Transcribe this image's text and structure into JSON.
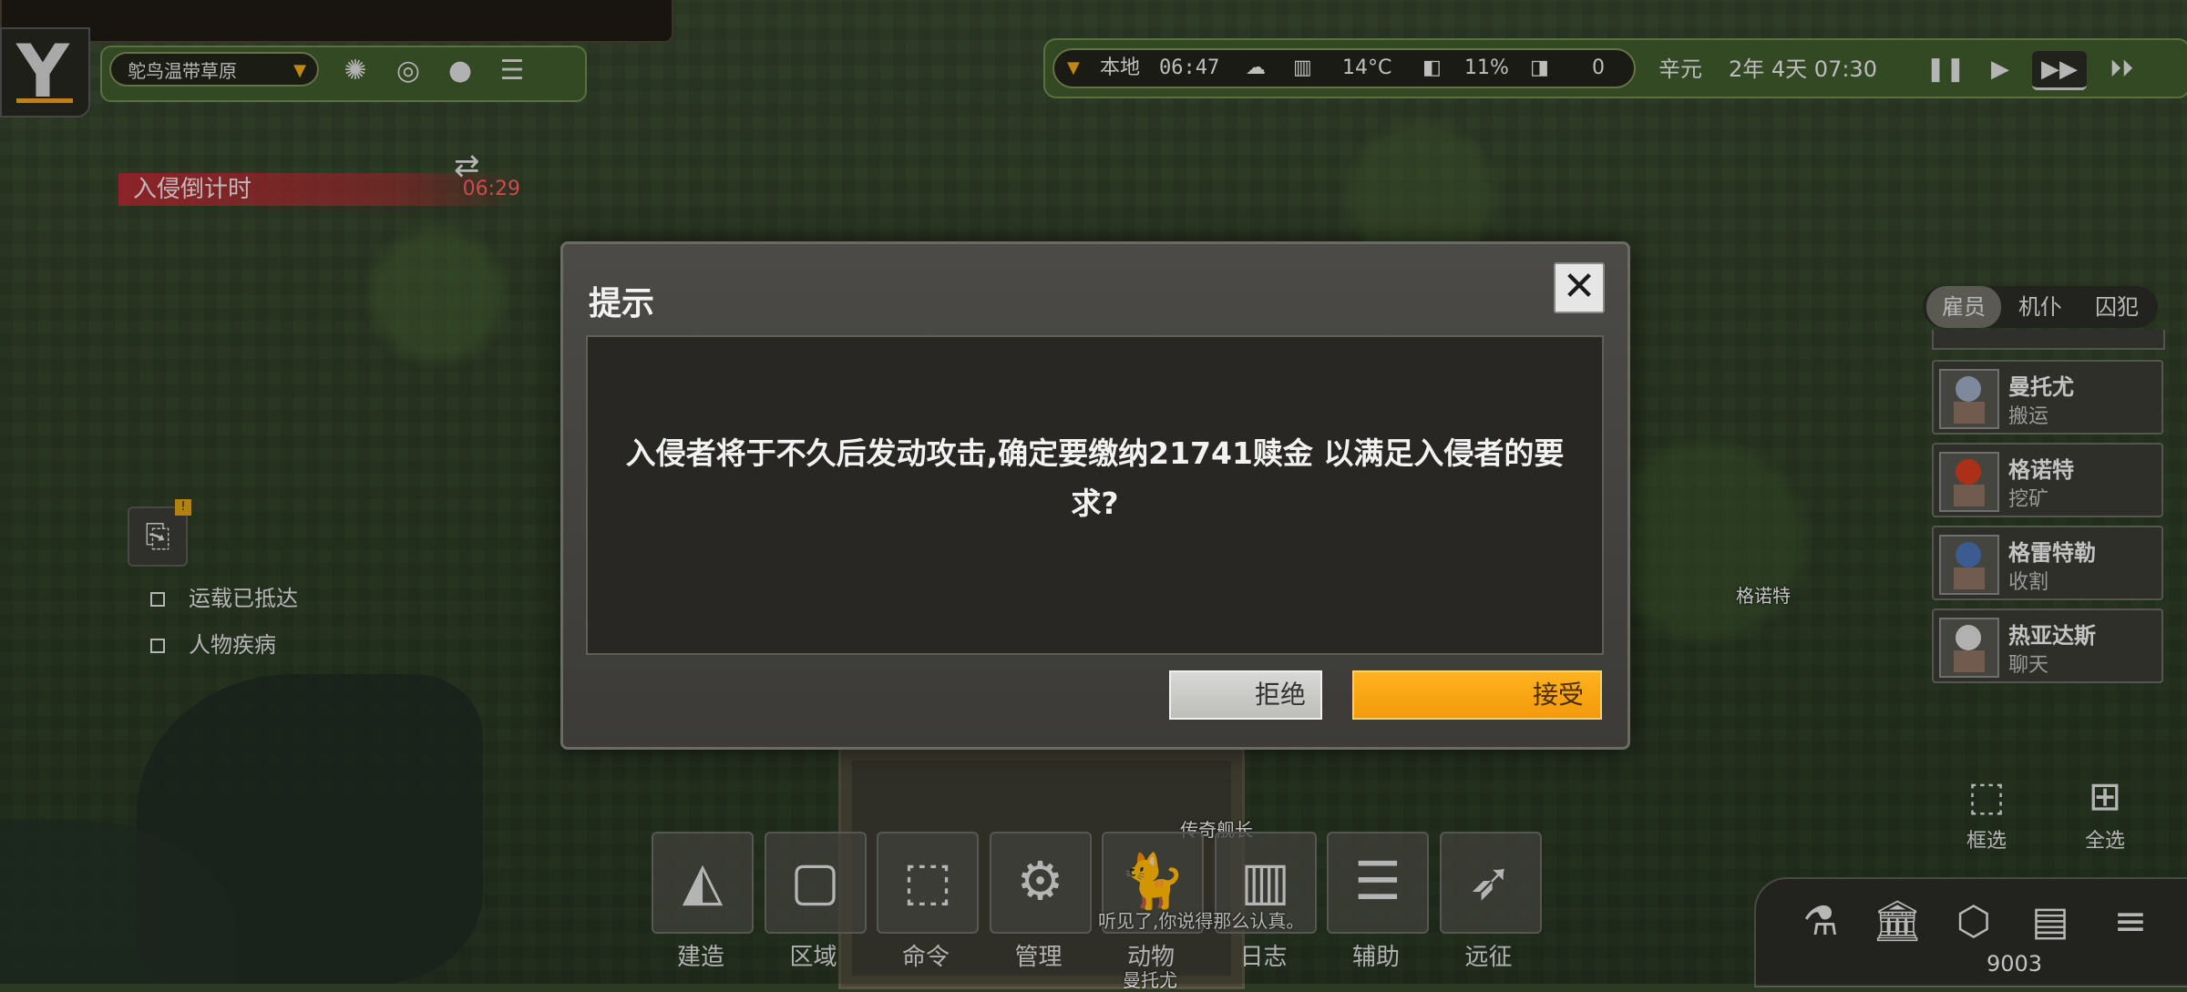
{
  "colors": {
    "accent": "#f5a00f",
    "invasion_red": "#c02835",
    "map_green": "#2f3f27"
  },
  "top_left": {
    "biome": "鸵鸟温带草原",
    "icons": [
      "storm-icon",
      "target-icon",
      "globe-icon",
      "layers-icon"
    ]
  },
  "status_bar": {
    "location": "本地",
    "local_time": "06:47",
    "temperature": "14°C",
    "humidity": "11%",
    "value": "0",
    "calendar": "辛元",
    "date": "2年 4天 07:30"
  },
  "invasion": {
    "label": "入侵倒计时",
    "timer": "06:29"
  },
  "alerts": [
    "运载已抵达",
    "人物疾病"
  ],
  "dialog": {
    "title": "提示",
    "message": "入侵者将于不久后发动攻击,确定要缴纳21741赎金 以满足入侵者的要求?",
    "reject": "拒绝",
    "accept": "接受"
  },
  "crew_tabs": [
    "雇员",
    "机仆",
    "囚犯"
  ],
  "crew": [
    {
      "name": "曼托尤",
      "job": "搬运",
      "color": "#9aa8c0"
    },
    {
      "name": "格诺特",
      "job": "挖矿",
      "color": "#d23a1e"
    },
    {
      "name": "格雷特勒",
      "job": "收割",
      "color": "#4a6fb0"
    },
    {
      "name": "热亚达斯",
      "job": "聊天",
      "color": "#d8d8d8"
    }
  ],
  "map_labels": {
    "colonist": "格诺特",
    "captain": "传奇舰长",
    "chat": "听见了,你说得那么认真。",
    "under": "曼托尤"
  },
  "select": {
    "box": "框选",
    "all": "全选"
  },
  "toolbar": [
    "建造",
    "区域",
    "命令",
    "管理",
    "动物",
    "日志",
    "辅助",
    "远征"
  ],
  "money": "9003"
}
